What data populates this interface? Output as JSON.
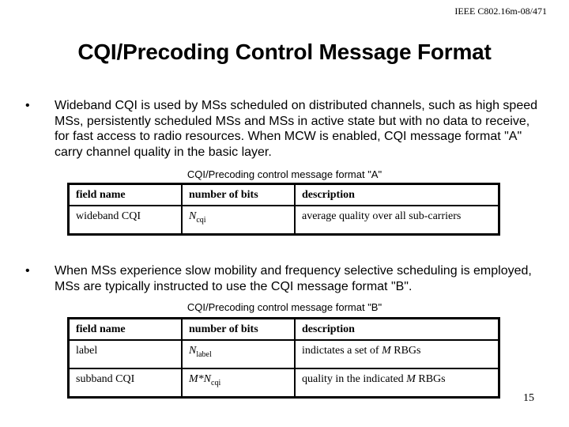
{
  "header": {
    "document_id": "IEEE C802.16m-08/471"
  },
  "title": "CQI/Precoding Control Message Format",
  "bullets": [
    {
      "marker": "•",
      "text": "Wideband  CQI is used by MSs scheduled on distributed channels, such as high speed MSs, persistently scheduled MSs and MSs in active state but with no data to receive, for fast access to radio resources. When MCW is enabled, CQI message format \"A\" carry channel quality in the basic layer."
    },
    {
      "marker": "•",
      "text": "When MSs experience slow mobility and frequency selective scheduling is employed, MSs are typically instructed to use the CQI message format \"B\"."
    }
  ],
  "table_a": {
    "caption": "CQI/Precoding control message format \"A\"",
    "headers": [
      "field name",
      "number of bits",
      "description"
    ],
    "rows": [
      {
        "field": "wideband CQI",
        "bits_prefix": "",
        "bits_symbol": "N",
        "bits_sub": "cqi",
        "description": "average quality over all sub-carriers"
      }
    ]
  },
  "table_b": {
    "caption": "CQI/Precoding control message format \"B\"",
    "headers": [
      "field name",
      "number of bits",
      "description"
    ],
    "rows": [
      {
        "field": "label",
        "bits_prefix": "",
        "bits_symbol": "N",
        "bits_sub": "label",
        "desc_before": "indictates a set of ",
        "desc_var": "M",
        "desc_after": " RBGs"
      },
      {
        "field": "subband CQI",
        "bits_prefix": "M*",
        "bits_symbol": "N",
        "bits_sub": "cqi",
        "desc_before": "quality in the indicated ",
        "desc_var": "M",
        "desc_after": " RBGs"
      }
    ]
  },
  "footer": {
    "page_number": "15"
  }
}
